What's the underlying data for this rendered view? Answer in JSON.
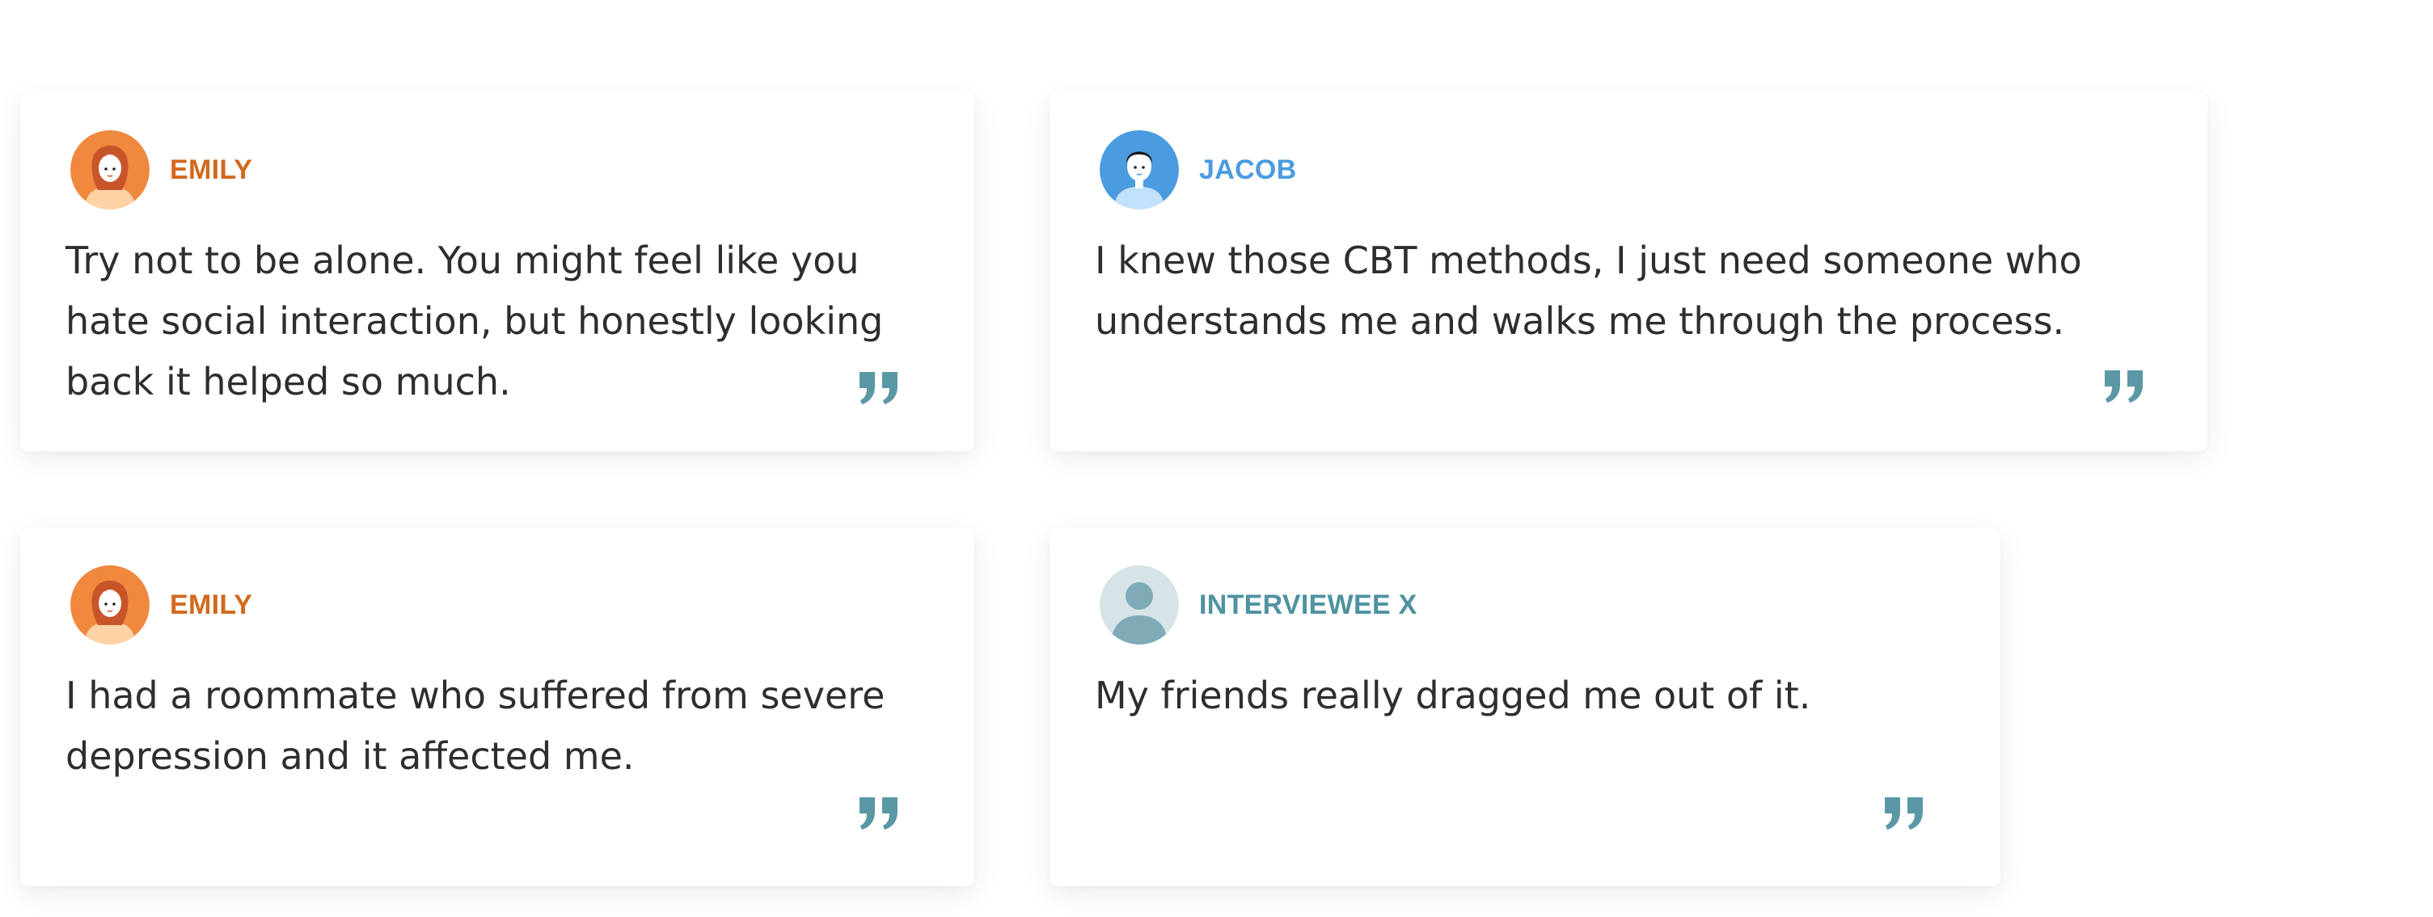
{
  "testimonials": [
    {
      "name": "EMILY",
      "avatar_icon": "female-avatar-icon",
      "name_color": "#D2691E",
      "quote": "Try not to be alone. You might feel like you hate social interaction, but honestly looking back it helped so much."
    },
    {
      "name": "JACOB",
      "avatar_icon": "male-avatar-icon",
      "name_color": "#4A9BE0",
      "quote": "I knew those CBT methods, I just need someone who understands me and walks me through the process."
    },
    {
      "name": "EMILY",
      "avatar_icon": "female-avatar-icon",
      "name_color": "#D2691E",
      "quote": "I had a roommate who suffered from severe depression and it affected me."
    },
    {
      "name": "INTERVIEWEE X",
      "avatar_icon": "anonymous-user-icon",
      "name_color": "#4E93A0",
      "quote": "My friends really dragged me out of it."
    }
  ],
  "quote_icon": "closing-quote-icon",
  "quote_icon_color": "#5B98A6",
  "text_color": "#2E2E2E"
}
